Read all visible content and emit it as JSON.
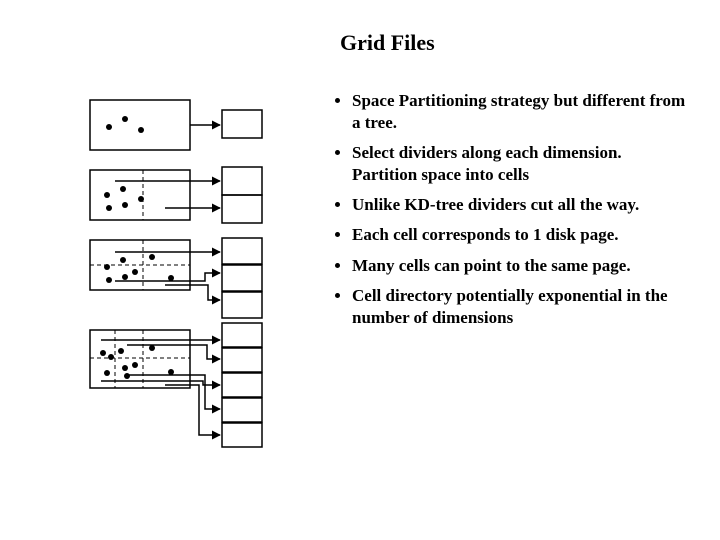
{
  "title": "Grid Files",
  "bullets": [
    "Space Partitioning strategy but different from a tree.",
    "Select dividers along each dimension. Partition space into cells",
    "Unlike KD-tree dividers cut all the way.",
    "Each cell corresponds to 1 disk page.",
    "Many cells can point to the same page.",
    "Cell directory potentially exponential in the number of dimensions"
  ]
}
